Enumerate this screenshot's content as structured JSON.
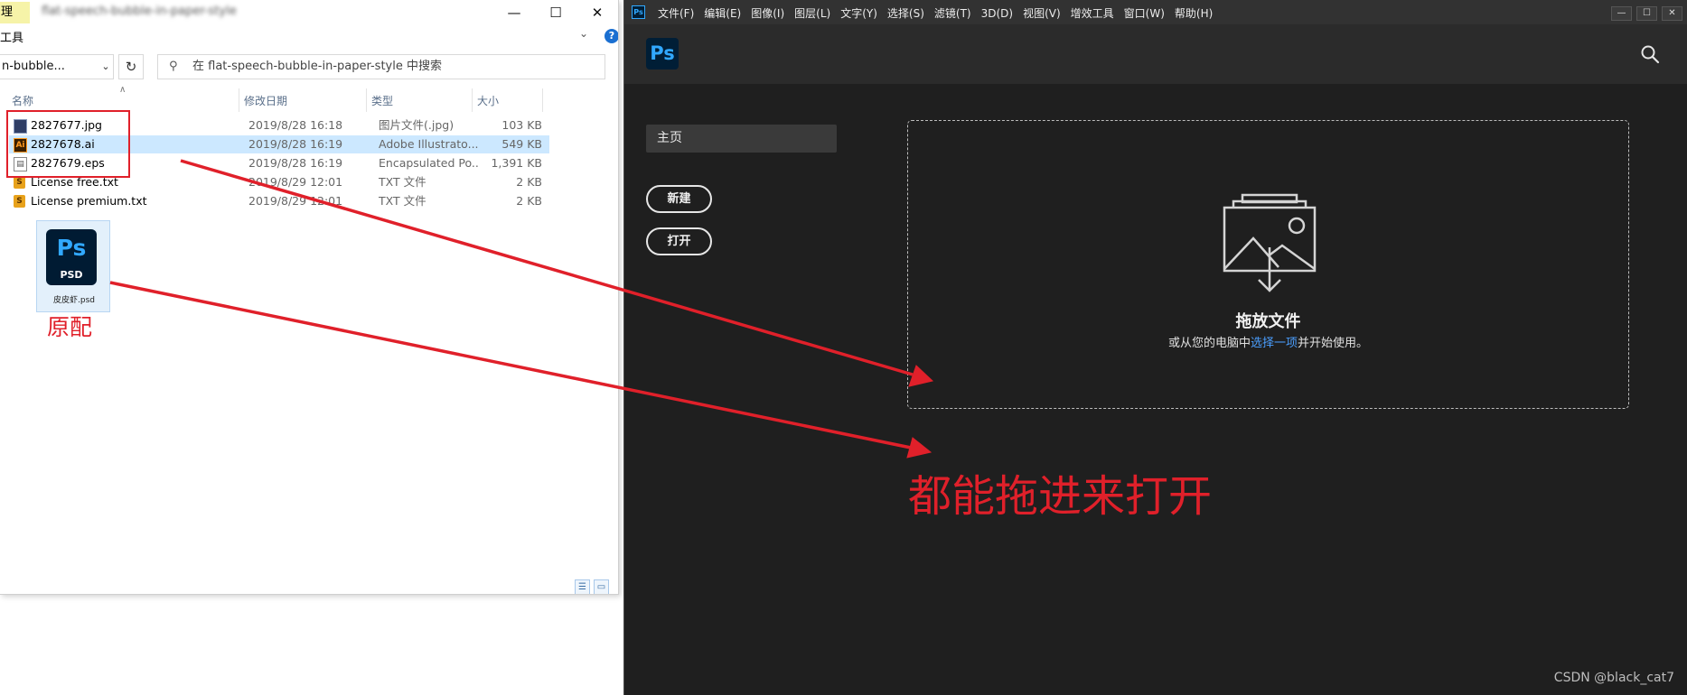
{
  "explorer": {
    "ribbon_fragment": "理",
    "tools_fragment": "工具",
    "address_fragment": "n-bubble...",
    "search_placeholder": "在 flat-speech-bubble-in-paper-style 中搜索",
    "columns": {
      "name": "名称",
      "date": "修改日期",
      "type": "类型",
      "size": "大小"
    },
    "files": [
      {
        "icon": "jpg-file-icon",
        "name": "2827677.jpg",
        "date": "2019/8/28 16:18",
        "type": "图片文件(.jpg)",
        "size": "103 KB",
        "selected": false
      },
      {
        "icon": "ai-file-icon",
        "name": "2827678.ai",
        "date": "2019/8/28 16:19",
        "type": "Adobe Illustrato...",
        "size": "549 KB",
        "selected": true
      },
      {
        "icon": "eps-file-icon",
        "name": "2827679.eps",
        "date": "2019/8/28 16:19",
        "type": "Encapsulated Po...",
        "size": "1,391 KB",
        "selected": false
      },
      {
        "icon": "txt-file-icon",
        "name": "License free.txt",
        "date": "2019/8/29 12:01",
        "type": "TXT 文件",
        "size": "2 KB",
        "selected": false
      },
      {
        "icon": "txt-file-icon",
        "name": "License premium.txt",
        "date": "2019/8/29 12:01",
        "type": "TXT 文件",
        "size": "2 KB",
        "selected": false
      }
    ],
    "psd_tile": {
      "logo": "Ps",
      "label": "PSD",
      "filename": "皮皮虾.psd"
    }
  },
  "annotations": {
    "original_label": "原配",
    "drag_note": "都能拖进来打开",
    "color": "#e0202a"
  },
  "photoshop": {
    "mini_logo": "Ps",
    "menu": [
      "文件(F)",
      "编辑(E)",
      "图像(I)",
      "图层(L)",
      "文字(Y)",
      "选择(S)",
      "滤镜(T)",
      "3D(D)",
      "视图(V)",
      "增效工具",
      "窗口(W)",
      "帮助(H)"
    ],
    "logo": "Ps",
    "home_label": "主页",
    "new_label": "新建",
    "open_label": "打开",
    "dropzone": {
      "title": "拖放文件",
      "sub_before": "或从您的电脑中",
      "sub_link": "选择一项",
      "sub_after": "并开始使用。"
    },
    "accent": "#31a8ff",
    "link_color": "#4b9fff"
  },
  "watermark": "CSDN @black_cat7"
}
